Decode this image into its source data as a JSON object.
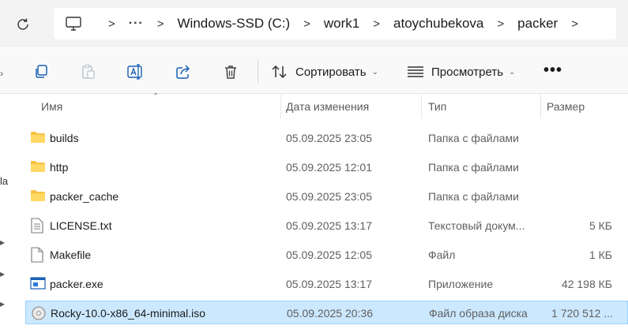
{
  "address_bar": {
    "overflow": "···",
    "breadcrumbs": [
      "Windows-SSD (C:)",
      "work1",
      "atoychubekova",
      "packer"
    ]
  },
  "command_bar": {
    "sort_label": "Сортировать",
    "view_label": "Просмотреть",
    "more": "•••"
  },
  "columns": {
    "name": "Имя",
    "date": "Дата изменения",
    "type": "Тип",
    "size": "Размер"
  },
  "files": [
    {
      "name": "builds",
      "date": "05.09.2025 23:05",
      "type": "Папка с файлами",
      "size": "",
      "icon": "folder-icon"
    },
    {
      "name": "http",
      "date": "05.09.2025 12:01",
      "type": "Папка с файлами",
      "size": "",
      "icon": "folder-icon"
    },
    {
      "name": "packer_cache",
      "date": "05.09.2025 23:05",
      "type": "Папка с файлами",
      "size": "",
      "icon": "folder-icon"
    },
    {
      "name": "LICENSE.txt",
      "date": "05.09.2025 13:17",
      "type": "Текстовый докум...",
      "size": "5 КБ",
      "icon": "text-file-icon"
    },
    {
      "name": "Makefile",
      "date": "05.09.2025 12:05",
      "type": "Файл",
      "size": "1 КБ",
      "icon": "file-icon"
    },
    {
      "name": "packer.exe",
      "date": "05.09.2025 13:17",
      "type": "Приложение",
      "size": "42 198 КБ",
      "icon": "exe-icon"
    },
    {
      "name": "Rocky-10.0-x86_64-minimal.iso",
      "date": "05.09.2025 20:36",
      "type": "Файл образа диска",
      "size": "1 720 512 ...",
      "icon": "disc-image-icon",
      "selected": true
    }
  ],
  "left_pane": {
    "partial_label": "la"
  },
  "colors": {
    "selection_bg": "#cce8ff",
    "selection_border": "#99d1ff",
    "folder": "#f6c343",
    "accent": "#1a5fb4"
  }
}
